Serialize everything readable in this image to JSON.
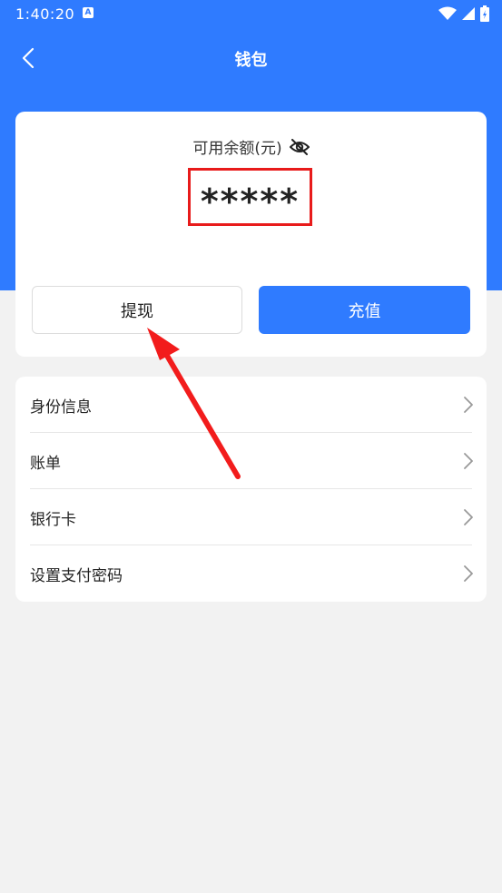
{
  "status_bar": {
    "time": "1:40:20",
    "notification_badge": "A"
  },
  "nav": {
    "title": "钱包"
  },
  "balance": {
    "label": "可用余额(元)",
    "value": "*****"
  },
  "actions": {
    "withdraw_label": "提现",
    "recharge_label": "充值"
  },
  "menu": {
    "items": [
      {
        "label": "身份信息"
      },
      {
        "label": "账单"
      },
      {
        "label": "银行卡"
      },
      {
        "label": "设置支付密码"
      }
    ]
  },
  "colors": {
    "primary": "#2f7bff",
    "highlight": "#e81b1b",
    "background": "#f2f2f2"
  }
}
